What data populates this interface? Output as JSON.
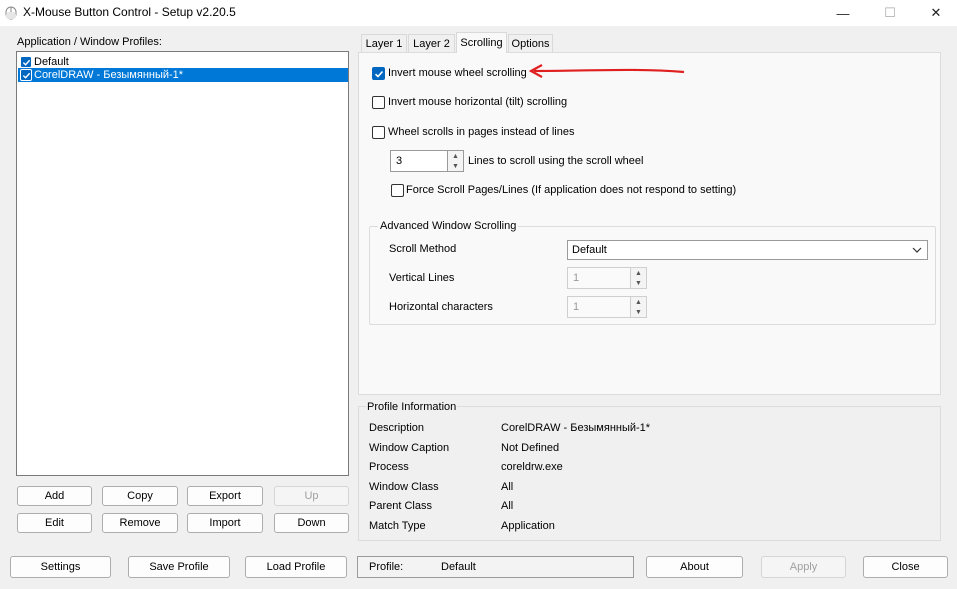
{
  "window": {
    "title": "X-Mouse Button Control - Setup v2.20.5",
    "controls": {
      "minimize": "—",
      "maximize": "☐",
      "close": "✕"
    }
  },
  "profiles": {
    "label": "Application / Window Profiles:",
    "items": [
      {
        "label": "Default",
        "checked": true,
        "selected": false
      },
      {
        "label": "CorelDRAW - Безымянный-1*",
        "checked": true,
        "selected": true
      }
    ],
    "buttons": {
      "add": "Add",
      "copy": "Copy",
      "export": "Export",
      "up": "Up",
      "edit": "Edit",
      "remove": "Remove",
      "import": "Import",
      "down": "Down"
    }
  },
  "tabs": [
    {
      "label": "Layer 1",
      "active": false
    },
    {
      "label": "Layer 2",
      "active": false
    },
    {
      "label": "Scrolling",
      "active": true
    },
    {
      "label": "Options",
      "active": false
    }
  ],
  "scrolling": {
    "invert_wheel": {
      "label": "Invert mouse wheel scrolling",
      "checked": true
    },
    "invert_tilt": {
      "label": "Invert mouse horizontal (tilt) scrolling",
      "checked": false
    },
    "scroll_pages": {
      "label": "Wheel scrolls in pages instead of lines",
      "checked": false
    },
    "lines_value": "3",
    "lines_label": "Lines to scroll using the scroll wheel",
    "force_scroll": {
      "label": "Force Scroll Pages/Lines (If application does not respond to setting)",
      "checked": false
    },
    "advanced": {
      "title": "Advanced Window Scrolling",
      "scroll_method_label": "Scroll Method",
      "scroll_method_value": "Default",
      "vertical_lines_label": "Vertical Lines",
      "vertical_lines_value": "1",
      "horizontal_chars_label": "Horizontal characters",
      "horizontal_chars_value": "1"
    }
  },
  "profile_info": {
    "title": "Profile Information",
    "rows": [
      {
        "key": "Description",
        "value": "CorelDRAW - Безымянный-1*"
      },
      {
        "key": "Window Caption",
        "value": "Not Defined"
      },
      {
        "key": "Process",
        "value": "coreldrw.exe"
      },
      {
        "key": "Window Class",
        "value": "All"
      },
      {
        "key": "Parent Class",
        "value": "All"
      },
      {
        "key": "Match Type",
        "value": "Application"
      }
    ]
  },
  "bottom": {
    "settings": "Settings",
    "save_profile": "Save Profile",
    "load_profile": "Load Profile",
    "status_label": "Profile:",
    "status_value": "Default",
    "about": "About",
    "apply": "Apply",
    "close": "Close"
  },
  "colors": {
    "accent": "#0067c0",
    "selection": "#0078d7",
    "annotation_arrow": "#e02020"
  }
}
